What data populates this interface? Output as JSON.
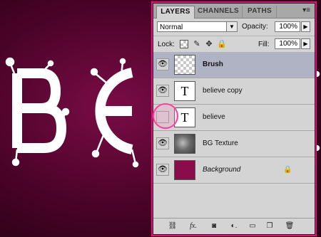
{
  "canvas": {
    "letters": [
      "B",
      "E"
    ],
    "background_color": "#4a0328",
    "letter_color": "#ffffff"
  },
  "tabs": [
    {
      "label": "LAYERS",
      "active": true
    },
    {
      "label": "CHANNELS",
      "active": false
    },
    {
      "label": "PATHS",
      "active": false
    }
  ],
  "blend_mode": "Normal",
  "opacity": {
    "label": "Opacity:",
    "value": "100%"
  },
  "fill": {
    "label": "Fill:",
    "value": "100%"
  },
  "lock_label": "Lock:",
  "layers": [
    {
      "name": "Brush",
      "visible": true,
      "selected": true,
      "thumb": "transparent"
    },
    {
      "name": "believe copy",
      "visible": true,
      "selected": false,
      "thumb": "text",
      "thumb_text": "T"
    },
    {
      "name": "believe",
      "visible": false,
      "selected": false,
      "thumb": "text",
      "thumb_text": "T"
    },
    {
      "name": "BG Texture",
      "visible": true,
      "selected": false,
      "thumb": "texture"
    },
    {
      "name": "Background",
      "visible": true,
      "selected": false,
      "thumb": "color",
      "locked": true
    }
  ],
  "icons": {
    "eye": "eye-icon",
    "menu": "panel-menu-icon"
  },
  "highlight_color": "#ff3f9b"
}
